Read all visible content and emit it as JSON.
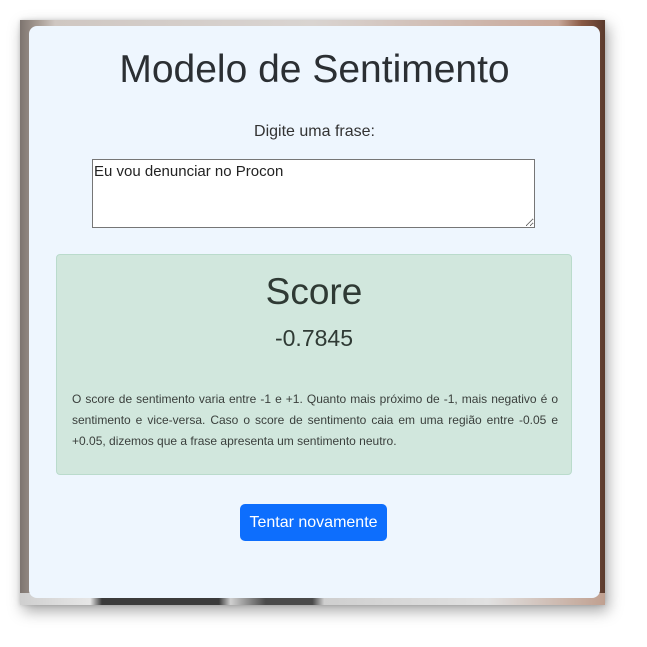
{
  "page": {
    "title": "Modelo de Sentimento",
    "prompt_label": "Digite uma frase:",
    "input_value": "Eu vou denunciar no Procon"
  },
  "result": {
    "heading": "Score",
    "value": "-0.7845",
    "explanation": "O score de sentimento varia entre -1 e +1. Quanto mais próximo de -1, mais negativo é o sentimento e vice-versa. Caso o score de sentimento caia em uma região entre -0.05 e +0.05, dizemos que a frase apresenta um sentimento neutro."
  },
  "actions": {
    "retry_label": "Tentar novamente"
  },
  "colors": {
    "card_background": "#eef6fe",
    "result_background": "#d1e7dd",
    "button_primary": "#0d6efd"
  }
}
